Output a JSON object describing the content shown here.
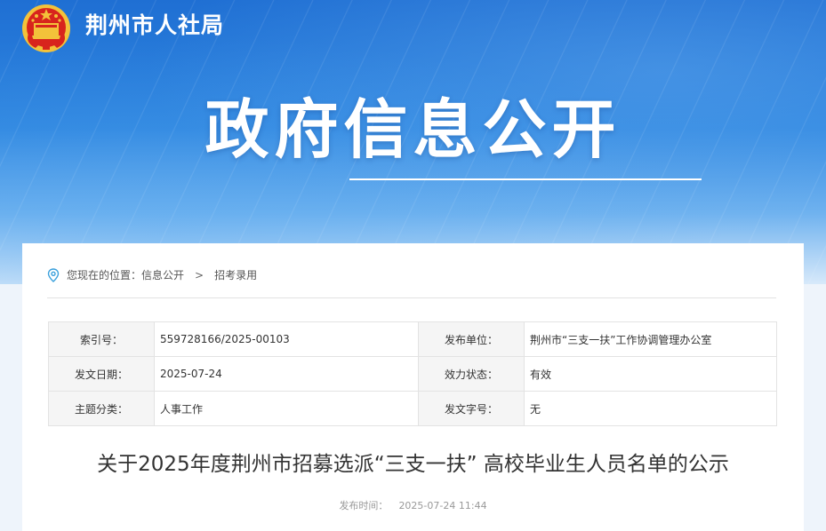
{
  "header": {
    "site_name": "荆州市人社局",
    "hero_title": "政府信息公开",
    "colors": {
      "banner_top": "#1f6fd3",
      "banner_bottom": "#d7e9fa",
      "emblem_red": "#d8241d",
      "emblem_gold": "#f3c23a"
    }
  },
  "breadcrumb": {
    "icon": "location-pin-icon",
    "prefix": "您现在的位置：",
    "items": [
      "信息公开",
      "招考录用"
    ],
    "separator": ">"
  },
  "meta_table": {
    "rows": [
      {
        "k1": "索引号：",
        "v1": "559728166/2025-00103",
        "k2": "发布单位：",
        "v2": "荆州市“三支一扶”工作协调管理办公室"
      },
      {
        "k1": "发文日期：",
        "v1": "2025-07-24",
        "k2": "效力状态：",
        "v2": "有效"
      },
      {
        "k1": "主题分类：",
        "v1": "人事工作",
        "k2": "发文字号：",
        "v2": "无"
      }
    ]
  },
  "article": {
    "title": "关于2025年度荆州市招募选派“三支一扶” 高校毕业生人员名单的公示",
    "publish_label": "发布时间：",
    "publish_time": "2025-07-24 11:44"
  }
}
